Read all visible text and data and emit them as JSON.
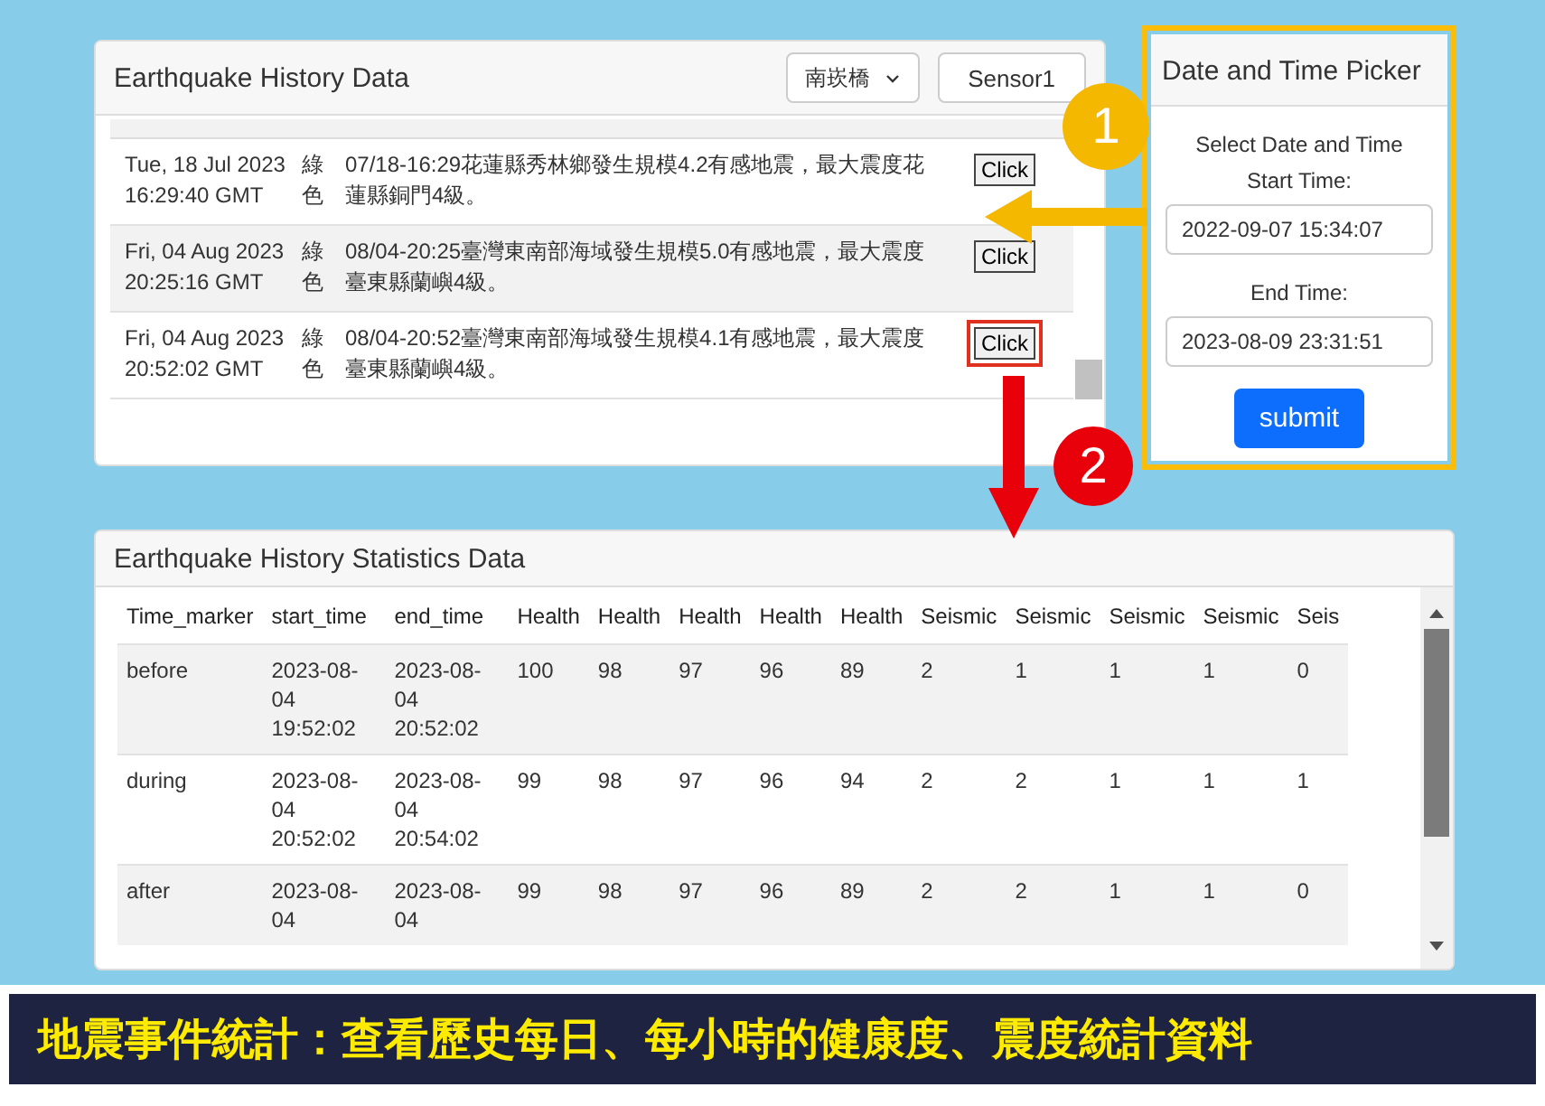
{
  "history": {
    "title": "Earthquake History Data",
    "station_select": "南崁橋",
    "sensor_button": "Sensor1",
    "rows": [
      {
        "time": "Tue, 18 Jul 2023 16:29:40 GMT",
        "level": "綠色",
        "message": "07/18-16:29花蓮縣秀林鄉發生規模4.2有感地震，最大震度花蓮縣銅門4級。",
        "button": "Click",
        "highlighted": false
      },
      {
        "time": "Fri, 04 Aug 2023 20:25:16 GMT",
        "level": "綠色",
        "message": "08/04-20:25臺灣東南部海域發生規模5.0有感地震，最大震度臺東縣蘭嶼4級。",
        "button": "Click",
        "highlighted": false
      },
      {
        "time": "Fri, 04 Aug 2023 20:52:02 GMT",
        "level": "綠色",
        "message": "08/04-20:52臺灣東南部海域發生規模4.1有感地震，最大震度臺東縣蘭嶼4級。",
        "button": "Click",
        "highlighted": true
      }
    ]
  },
  "picker": {
    "title": "Date and Time Picker",
    "subtitle": "Select Date and Time",
    "start_label": "Start Time:",
    "start_value": "2022-09-07 15:34:07",
    "end_label": "End Time:",
    "end_value": "2023-08-09 23:31:51",
    "submit": "submit"
  },
  "statistics": {
    "title": "Earthquake History Statistics Data",
    "columns": [
      "Time_marker",
      "start_time",
      "end_time",
      "Health",
      "Health",
      "Health",
      "Health",
      "Health",
      "Seismic",
      "Seismic",
      "Seismic",
      "Seismic",
      "Seis"
    ],
    "rows": [
      [
        "before",
        "2023-08-04 19:52:02",
        "2023-08-04 20:52:02",
        "100",
        "98",
        "97",
        "96",
        "89",
        "2",
        "1",
        "1",
        "1",
        "0"
      ],
      [
        "during",
        "2023-08-04 20:52:02",
        "2023-08-04 20:54:02",
        "99",
        "98",
        "97",
        "96",
        "94",
        "2",
        "2",
        "1",
        "1",
        "1"
      ],
      [
        "after",
        "2023-08-04",
        "2023-08-04",
        "99",
        "98",
        "97",
        "96",
        "89",
        "2",
        "2",
        "1",
        "1",
        "0"
      ]
    ]
  },
  "callouts": [
    "1",
    "2"
  ],
  "caption": "地震事件統計：查看歷史每日、每小時的健康度、震度統計資料"
}
